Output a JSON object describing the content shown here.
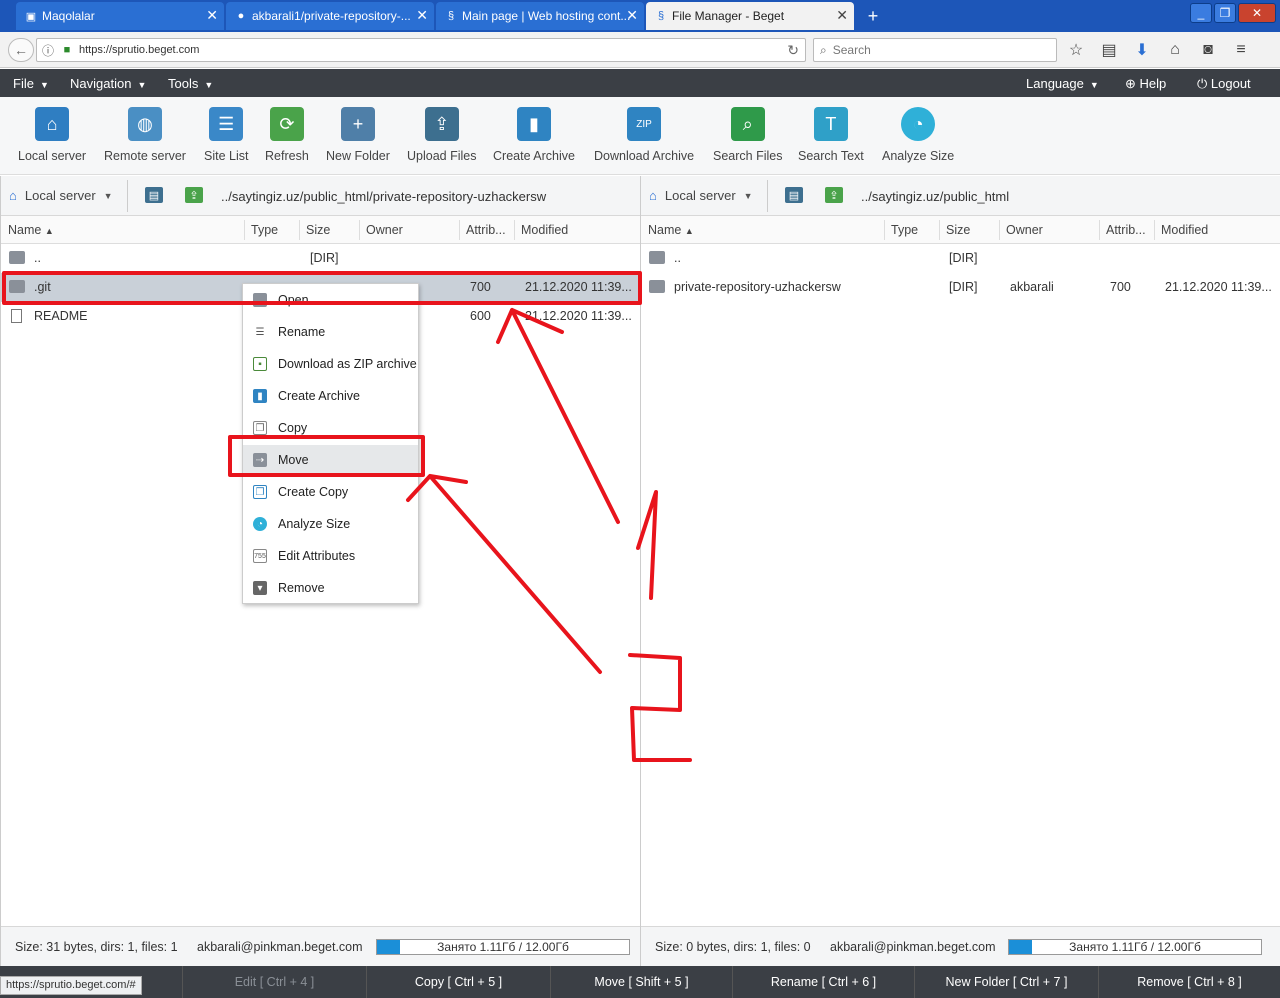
{
  "browser": {
    "tabs": [
      {
        "title": "Maqolalar",
        "icon": "article-icon"
      },
      {
        "title": "akbarali1/private-repository-...",
        "icon": "github-icon"
      },
      {
        "title": "Main page | Web hosting cont...",
        "icon": "beget-icon"
      },
      {
        "title": "File Manager - Beget",
        "icon": "beget-icon",
        "active": true
      }
    ],
    "url": "https://sprutio.beget.com",
    "search_placeholder": "Search",
    "status_url": "https://sprutio.beget.com/#"
  },
  "app_menu": {
    "file": "File",
    "navigation": "Navigation",
    "tools": "Tools",
    "language": "Language",
    "help": "Help",
    "logout": "Logout"
  },
  "toolbar": [
    {
      "label": "Local server",
      "icon": "home-icon",
      "color": "#2f7ec2"
    },
    {
      "label": "Remote server",
      "icon": "globe-folder-icon",
      "color": "#4a8fc4"
    },
    {
      "label": "Site List",
      "icon": "site-list-icon",
      "color": "#3a88c8"
    },
    {
      "label": "Refresh",
      "icon": "refresh-icon",
      "color": "#4aa34a"
    },
    {
      "label": "New Folder",
      "icon": "new-folder-icon",
      "color": "#4f7fa8"
    },
    {
      "label": "Upload Files",
      "icon": "upload-icon",
      "color": "#3d6f8f"
    },
    {
      "label": "Create Archive",
      "icon": "archive-icon",
      "color": "#2f84c2"
    },
    {
      "label": "Download Archive",
      "icon": "zip-download-icon",
      "color": "#2f84c2"
    },
    {
      "label": "Search Files",
      "icon": "search-files-icon",
      "color": "#2f9a4a"
    },
    {
      "label": "Search Text",
      "icon": "search-text-icon",
      "color": "#2fa0c8"
    },
    {
      "label": "Analyze Size",
      "icon": "pie-chart-icon",
      "color": "#2fb0d8"
    }
  ],
  "left_panel": {
    "server": "Local server",
    "path": "../saytingiz.uz/public_html/private-repository-uzhackersw",
    "columns": [
      "Name",
      "Type",
      "Size",
      "Owner",
      "Attrib...",
      "Modified"
    ],
    "rows": [
      {
        "name": "..",
        "type": "",
        "size": "[DIR]",
        "owner": "",
        "attrib": "",
        "modified": "",
        "kind": "folder"
      },
      {
        "name": ".git",
        "type": "",
        "size": "",
        "owner": "",
        "attrib": "700",
        "modified": "21.12.2020 11:39...",
        "kind": "folder",
        "selected": true
      },
      {
        "name": "README",
        "type": "",
        "size": "",
        "owner": "",
        "attrib": "600",
        "modified": "21.12.2020 11:39...",
        "kind": "file"
      }
    ],
    "status": "Size: 31 bytes, dirs: 1, files: 1",
    "account": "akbarali@pinkman.beget.com",
    "quota": "Занято 1.11Гб / 12.00Гб",
    "quota_fraction": 0.0925
  },
  "right_panel": {
    "server": "Local server",
    "path": "../saytingiz.uz/public_html",
    "columns": [
      "Name",
      "Type",
      "Size",
      "Owner",
      "Attrib...",
      "Modified"
    ],
    "rows": [
      {
        "name": "..",
        "type": "",
        "size": "[DIR]",
        "owner": "",
        "attrib": "",
        "modified": "",
        "kind": "folder"
      },
      {
        "name": "private-repository-uzhackersw",
        "type": "",
        "size": "[DIR]",
        "owner": "akbarali",
        "attrib": "700",
        "modified": "21.12.2020 11:39...",
        "kind": "folder"
      }
    ],
    "status": "Size: 0 bytes, dirs: 1, files: 0",
    "account": "akbarali@pinkman.beget.com",
    "quota": "Занято 1.11Гб / 12.00Гб",
    "quota_fraction": 0.0925
  },
  "context_menu": [
    {
      "label": "Open",
      "icon": "folder-open-icon"
    },
    {
      "label": "Rename",
      "icon": "rename-icon"
    },
    {
      "label": "Download as ZIP archive",
      "icon": "zip-icon"
    },
    {
      "label": "Create Archive",
      "icon": "archive-icon"
    },
    {
      "label": "Copy",
      "icon": "copy-icon"
    },
    {
      "label": "Move",
      "icon": "move-icon",
      "hover": true
    },
    {
      "label": "Create Copy",
      "icon": "create-copy-icon"
    },
    {
      "label": "Analyze Size",
      "icon": "pie-chart-icon"
    },
    {
      "label": "Edit Attributes",
      "icon": "attributes-icon"
    },
    {
      "label": "Remove",
      "icon": "trash-icon"
    }
  ],
  "fkeys": [
    {
      "label": "Edit [ Ctrl + 4 ]",
      "disabled": true
    },
    {
      "label": "Copy [ Ctrl + 5 ]"
    },
    {
      "label": "Move [ Shift + 5 ]"
    },
    {
      "label": "Rename [ Ctrl + 6 ]"
    },
    {
      "label": "New Folder [ Ctrl + 7 ]"
    },
    {
      "label": "Remove [ Ctrl + 8 ]"
    }
  ],
  "colors": {
    "menubar": "#3b3f45",
    "annotation": "#e8141c",
    "selection": "#c9d0d8"
  }
}
